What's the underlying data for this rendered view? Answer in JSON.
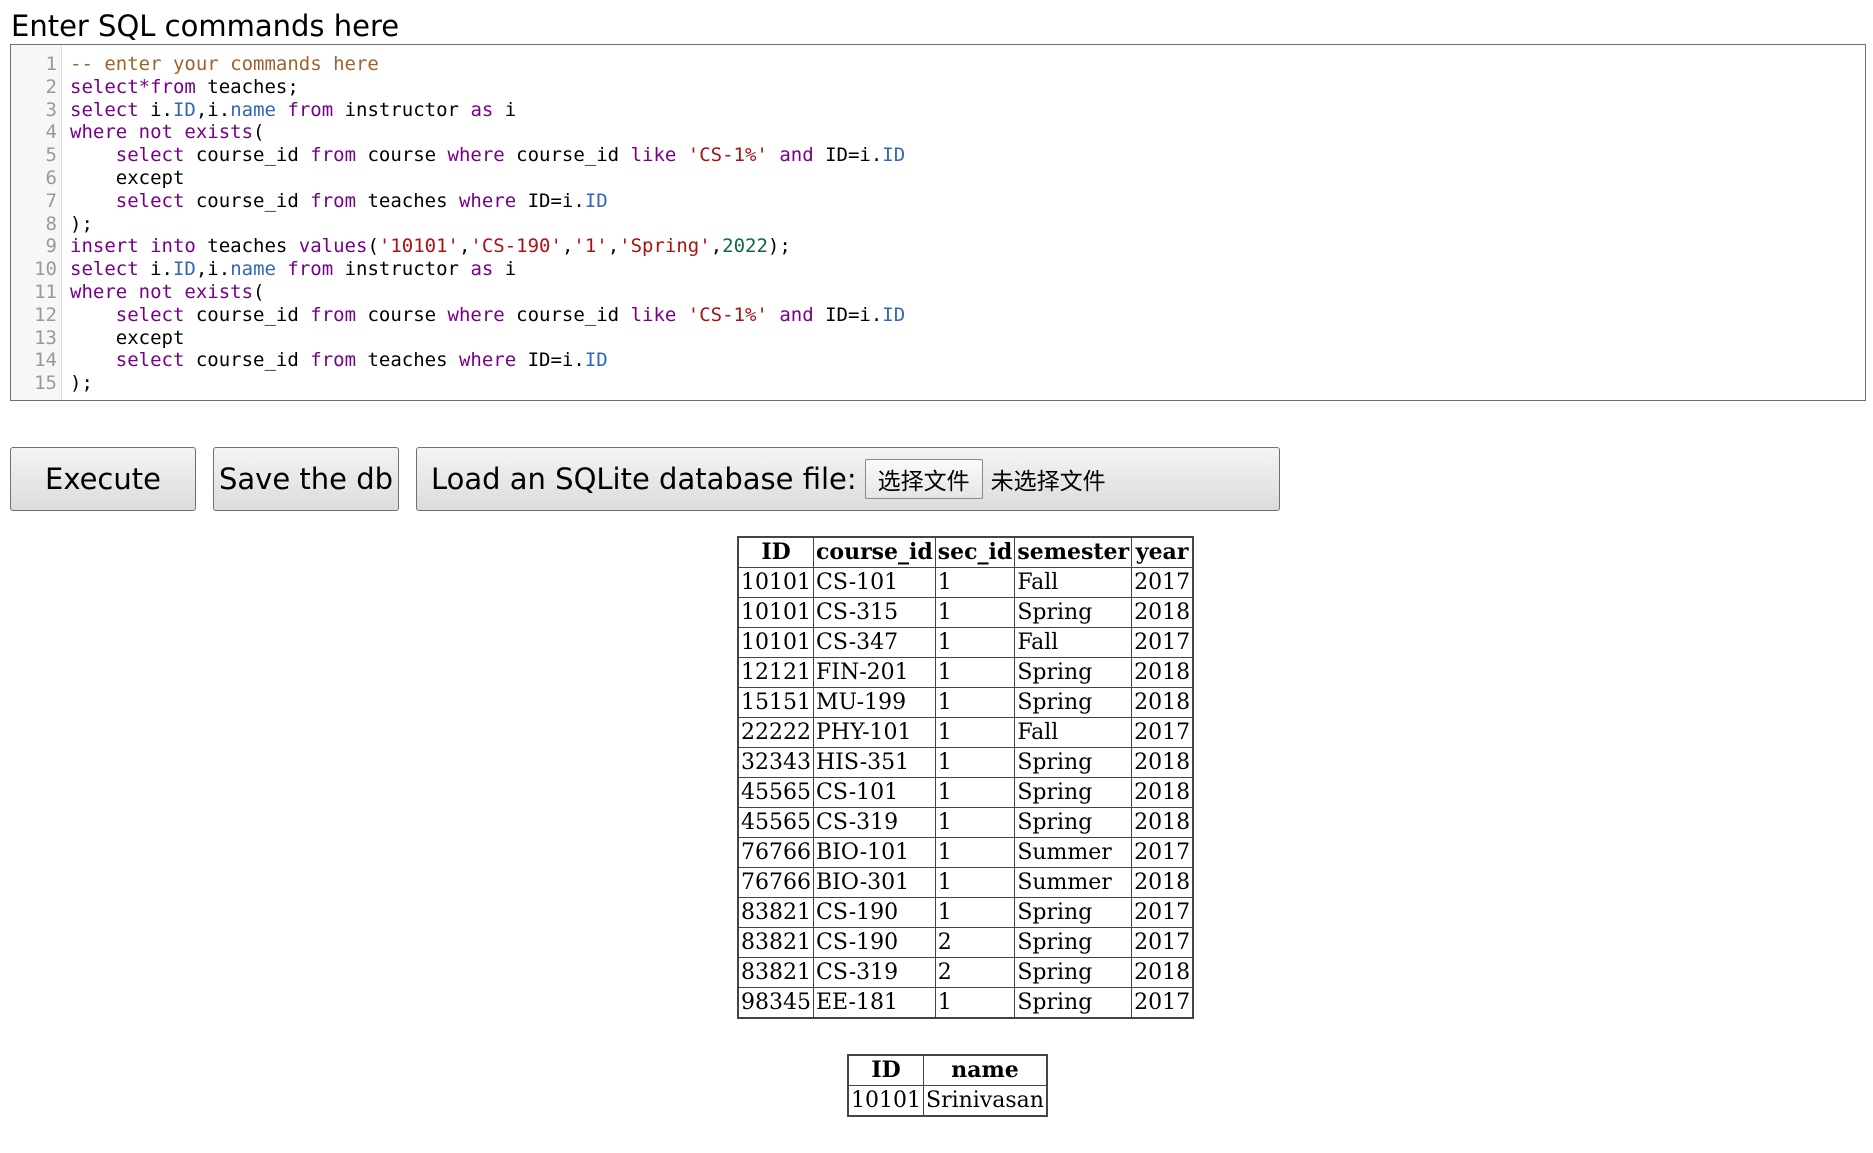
{
  "heading": "Enter SQL commands here",
  "editor": {
    "lines": [
      {
        "number": "1",
        "tokens": [
          {
            "t": "-- enter your commands here",
            "c": "comment"
          }
        ]
      },
      {
        "number": "2",
        "tokens": [
          {
            "t": "select",
            "c": "keyword"
          },
          {
            "t": "*",
            "c": "keyword"
          },
          {
            "t": "from",
            "c": "keyword"
          },
          {
            "t": " teaches;",
            "c": "plain"
          }
        ]
      },
      {
        "number": "3",
        "tokens": [
          {
            "t": "select",
            "c": "keyword"
          },
          {
            "t": " i.",
            "c": "plain"
          },
          {
            "t": "ID",
            "c": "builtin"
          },
          {
            "t": ",i.",
            "c": "plain"
          },
          {
            "t": "name",
            "c": "builtin"
          },
          {
            "t": " ",
            "c": "plain"
          },
          {
            "t": "from",
            "c": "keyword"
          },
          {
            "t": " instructor ",
            "c": "plain"
          },
          {
            "t": "as",
            "c": "keyword"
          },
          {
            "t": " i",
            "c": "plain"
          }
        ]
      },
      {
        "number": "4",
        "tokens": [
          {
            "t": "where not exists",
            "c": "keyword"
          },
          {
            "t": "(",
            "c": "plain"
          }
        ]
      },
      {
        "number": "5",
        "tokens": [
          {
            "t": "    ",
            "c": "plain"
          },
          {
            "t": "select",
            "c": "keyword"
          },
          {
            "t": " course_id ",
            "c": "plain"
          },
          {
            "t": "from",
            "c": "keyword"
          },
          {
            "t": " course ",
            "c": "plain"
          },
          {
            "t": "where",
            "c": "keyword"
          },
          {
            "t": " course_id ",
            "c": "plain"
          },
          {
            "t": "like",
            "c": "keyword"
          },
          {
            "t": " ",
            "c": "plain"
          },
          {
            "t": "'CS-1%'",
            "c": "string"
          },
          {
            "t": " ",
            "c": "plain"
          },
          {
            "t": "and",
            "c": "keyword"
          },
          {
            "t": " ID=i.",
            "c": "plain"
          },
          {
            "t": "ID",
            "c": "builtin"
          }
        ]
      },
      {
        "number": "6",
        "tokens": [
          {
            "t": "    except",
            "c": "plain"
          }
        ]
      },
      {
        "number": "7",
        "tokens": [
          {
            "t": "    ",
            "c": "plain"
          },
          {
            "t": "select",
            "c": "keyword"
          },
          {
            "t": " course_id ",
            "c": "plain"
          },
          {
            "t": "from",
            "c": "keyword"
          },
          {
            "t": " teaches ",
            "c": "plain"
          },
          {
            "t": "where",
            "c": "keyword"
          },
          {
            "t": " ID=i.",
            "c": "plain"
          },
          {
            "t": "ID",
            "c": "builtin"
          }
        ]
      },
      {
        "number": "8",
        "tokens": [
          {
            "t": ");",
            "c": "plain"
          }
        ]
      },
      {
        "number": "9",
        "tokens": [
          {
            "t": "insert into",
            "c": "keyword"
          },
          {
            "t": " teaches ",
            "c": "plain"
          },
          {
            "t": "values",
            "c": "keyword"
          },
          {
            "t": "(",
            "c": "plain"
          },
          {
            "t": "'10101'",
            "c": "string"
          },
          {
            "t": ",",
            "c": "plain"
          },
          {
            "t": "'CS-190'",
            "c": "string"
          },
          {
            "t": ",",
            "c": "plain"
          },
          {
            "t": "'1'",
            "c": "string"
          },
          {
            "t": ",",
            "c": "plain"
          },
          {
            "t": "'Spring'",
            "c": "string"
          },
          {
            "t": ",",
            "c": "plain"
          },
          {
            "t": "2022",
            "c": "number"
          },
          {
            "t": ");",
            "c": "plain"
          }
        ]
      },
      {
        "number": "10",
        "tokens": [
          {
            "t": "select",
            "c": "keyword"
          },
          {
            "t": " i.",
            "c": "plain"
          },
          {
            "t": "ID",
            "c": "builtin"
          },
          {
            "t": ",i.",
            "c": "plain"
          },
          {
            "t": "name",
            "c": "builtin"
          },
          {
            "t": " ",
            "c": "plain"
          },
          {
            "t": "from",
            "c": "keyword"
          },
          {
            "t": " instructor ",
            "c": "plain"
          },
          {
            "t": "as",
            "c": "keyword"
          },
          {
            "t": " i",
            "c": "plain"
          }
        ]
      },
      {
        "number": "11",
        "tokens": [
          {
            "t": "where not exists",
            "c": "keyword"
          },
          {
            "t": "(",
            "c": "plain"
          }
        ]
      },
      {
        "number": "12",
        "tokens": [
          {
            "t": "    ",
            "c": "plain"
          },
          {
            "t": "select",
            "c": "keyword"
          },
          {
            "t": " course_id ",
            "c": "plain"
          },
          {
            "t": "from",
            "c": "keyword"
          },
          {
            "t": " course ",
            "c": "plain"
          },
          {
            "t": "where",
            "c": "keyword"
          },
          {
            "t": " course_id ",
            "c": "plain"
          },
          {
            "t": "like",
            "c": "keyword"
          },
          {
            "t": " ",
            "c": "plain"
          },
          {
            "t": "'CS-1%'",
            "c": "string"
          },
          {
            "t": " ",
            "c": "plain"
          },
          {
            "t": "and",
            "c": "keyword"
          },
          {
            "t": " ID=i.",
            "c": "plain"
          },
          {
            "t": "ID",
            "c": "builtin"
          }
        ]
      },
      {
        "number": "13",
        "tokens": [
          {
            "t": "    except",
            "c": "plain"
          }
        ]
      },
      {
        "number": "14",
        "tokens": [
          {
            "t": "    ",
            "c": "plain"
          },
          {
            "t": "select",
            "c": "keyword"
          },
          {
            "t": " course_id ",
            "c": "plain"
          },
          {
            "t": "from",
            "c": "keyword"
          },
          {
            "t": " teaches ",
            "c": "plain"
          },
          {
            "t": "where",
            "c": "keyword"
          },
          {
            "t": " ID=i.",
            "c": "plain"
          },
          {
            "t": "ID",
            "c": "builtin"
          }
        ]
      },
      {
        "number": "15",
        "tokens": [
          {
            "t": ");",
            "c": "plain"
          }
        ]
      }
    ]
  },
  "buttons": {
    "execute": "Execute",
    "save": "Save the db",
    "load_label": "Load an SQLite database file:",
    "choose_file": "选择文件",
    "file_status": "未选择文件"
  },
  "results": [
    {
      "columns": [
        "ID",
        "course_id",
        "sec_id",
        "semester",
        "year"
      ],
      "rows": [
        [
          "10101",
          "CS-101",
          "1",
          "Fall",
          "2017"
        ],
        [
          "10101",
          "CS-315",
          "1",
          "Spring",
          "2018"
        ],
        [
          "10101",
          "CS-347",
          "1",
          "Fall",
          "2017"
        ],
        [
          "12121",
          "FIN-201",
          "1",
          "Spring",
          "2018"
        ],
        [
          "15151",
          "MU-199",
          "1",
          "Spring",
          "2018"
        ],
        [
          "22222",
          "PHY-101",
          "1",
          "Fall",
          "2017"
        ],
        [
          "32343",
          "HIS-351",
          "1",
          "Spring",
          "2018"
        ],
        [
          "45565",
          "CS-101",
          "1",
          "Spring",
          "2018"
        ],
        [
          "45565",
          "CS-319",
          "1",
          "Spring",
          "2018"
        ],
        [
          "76766",
          "BIO-101",
          "1",
          "Summer",
          "2017"
        ],
        [
          "76766",
          "BIO-301",
          "1",
          "Summer",
          "2018"
        ],
        [
          "83821",
          "CS-190",
          "1",
          "Spring",
          "2017"
        ],
        [
          "83821",
          "CS-190",
          "2",
          "Spring",
          "2017"
        ],
        [
          "83821",
          "CS-319",
          "2",
          "Spring",
          "2018"
        ],
        [
          "98345",
          "EE-181",
          "1",
          "Spring",
          "2017"
        ]
      ]
    },
    {
      "columns": [
        "ID",
        "name"
      ],
      "rows": [
        [
          "10101",
          "Srinivasan"
        ]
      ]
    }
  ],
  "colors": {
    "comment": "#a0622d",
    "keyword": "#770088",
    "builtin": "#3366bb",
    "string": "#aa1111",
    "number": "#116644"
  }
}
